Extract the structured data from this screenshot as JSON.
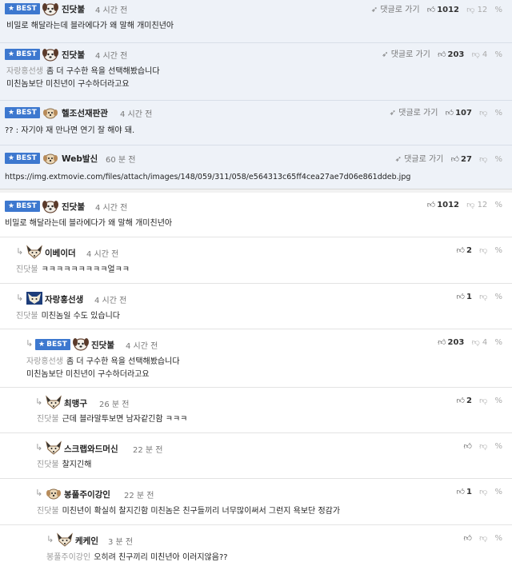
{
  "best_list": [
    {
      "badge": "BEST",
      "nick": "진닷불",
      "time": "4 시간 전",
      "reply": "댓글로 가기",
      "up": "1012",
      "down": "12",
      "text": "비밀로 해달라는데 블라에다가 왜 말해 개미친년아"
    },
    {
      "badge": "BEST",
      "nick": "진닷불",
      "time": "4 시간 전",
      "reply": "댓글로 가기",
      "up": "203",
      "down": "4",
      "line1": "자랑홍선생",
      "line1b": "좀 더 구수한 욕을 선택해봤습니다",
      "line2": "미친놈보단 미친년이 구수하더라고요"
    },
    {
      "badge": "BEST",
      "nick": "헬조선재판관",
      "time": "4 시간 전",
      "reply": "댓글로 가기",
      "up": "107",
      "down": "",
      "text": "?? : 자기야 재 만나면 연기 잘 해야 돼."
    },
    {
      "badge": "BEST",
      "nick": "Web발신",
      "time": "60 분 전",
      "reply": "댓글로 가기",
      "up": "27",
      "down": "",
      "text": "https://img.extmovie.com/files/attach/images/148/059/311/058/e564313c65ff4cea27ae7d06e861ddeb.jpg"
    }
  ],
  "thread": {
    "root": {
      "badge": "BEST",
      "nick": "진닷불",
      "time": "4 시간 전",
      "up": "1012",
      "down": "12",
      "text": "비밀로 해달라는데 블라에다가 왜 말해 개미친년아"
    },
    "c1": {
      "nick": "이베이더",
      "time": "4 시간 전",
      "up": "2",
      "down": "",
      "mention": "진닷불",
      "text": "ㅋㅋㅋㅋㅋㅋㅋㅋㅋ얼ㅋㅋ"
    },
    "c2": {
      "nick": "자랑홍선생",
      "time": "4 시간 전",
      "up": "1",
      "down": "",
      "mention": "진닷불",
      "text": "미친놈일 수도 있습니다"
    },
    "c3": {
      "badge": "BEST",
      "nick": "진닷불",
      "time": "4 시간 전",
      "up": "203",
      "down": "4",
      "mention": "자랑홍선생",
      "text": "좀 더 구수한 욕을 선택해봤습니다",
      "text2": "미친놈보단 미친년이 구수하더라고요"
    },
    "c4": {
      "nick": "최맹구",
      "time": "26 분 전",
      "up": "2",
      "down": "",
      "mention": "진닷불",
      "text": "근데 블라말투보면 남자같긴함 ㅋㅋㅋ"
    },
    "c5": {
      "nick": "스크랩와드머신",
      "time": "22 분 전",
      "up": "",
      "down": "",
      "mention": "진닷불",
      "text": "찰지긴해"
    },
    "c6": {
      "nick": "봉풀주이강인",
      "time": "22 분 전",
      "up": "1",
      "down": "",
      "mention": "진닷불",
      "text": "미친년이 확실히 찰지긴함 미친놈은 친구들끼리 너무많이써서 그런지 욕보단 정감가"
    },
    "c7": {
      "nick": "케케인",
      "time": "3 분 전",
      "up": "",
      "down": "",
      "mention": "봉풀주이강인",
      "text": "오히려 친구끼리 미친년아 이러지않음??"
    }
  },
  "icons": {
    "reply": "reply-arrow-icon",
    "up": "thumbs-up-icon",
    "down": "thumbs-down-icon",
    "link": "link-icon",
    "star": "star-icon"
  },
  "colors": {
    "badge": "#3d78cf",
    "best_bg": "#eef2f8"
  }
}
